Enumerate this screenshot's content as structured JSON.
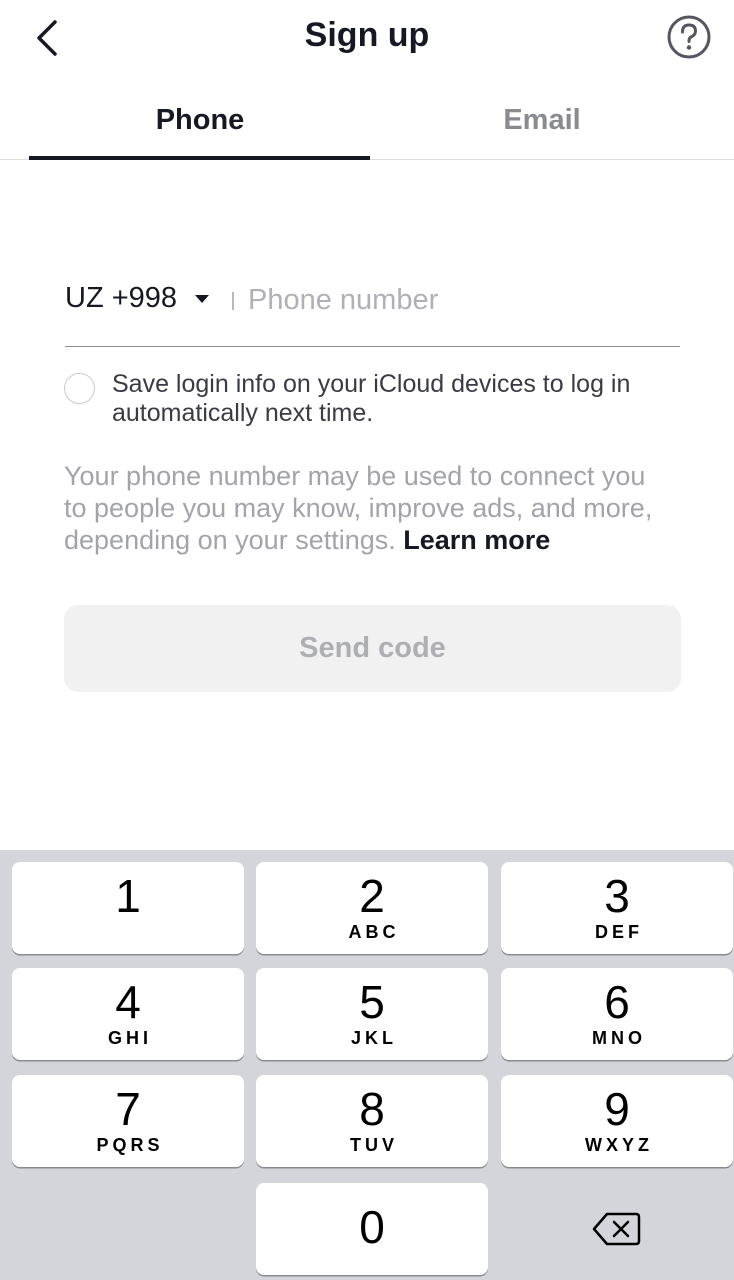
{
  "header": {
    "title": "Sign up",
    "back_icon": "chevron-left-icon",
    "help_icon": "question-circle-icon"
  },
  "tabs": [
    {
      "label": "Phone",
      "active": true
    },
    {
      "label": "Email",
      "active": false
    }
  ],
  "phone_form": {
    "country_code": "UZ +998",
    "phone_placeholder": "Phone number",
    "phone_value": ""
  },
  "save_login": {
    "checked": false,
    "label": "Save login info on your iCloud devices to log in automatically next time."
  },
  "info": {
    "text": "Your phone number may be used to connect you to people you may know, improve ads, and more, depending on your settings. ",
    "link_label": "Learn more"
  },
  "send_button": {
    "label": "Send code",
    "enabled": false
  },
  "keypad": {
    "keys": [
      {
        "number": "1",
        "letters": ""
      },
      {
        "number": "2",
        "letters": "ABC"
      },
      {
        "number": "3",
        "letters": "DEF"
      },
      {
        "number": "4",
        "letters": "GHI"
      },
      {
        "number": "5",
        "letters": "JKL"
      },
      {
        "number": "6",
        "letters": "MNO"
      },
      {
        "number": "7",
        "letters": "PQRS"
      },
      {
        "number": "8",
        "letters": "TUV"
      },
      {
        "number": "9",
        "letters": "WXYZ"
      },
      {
        "number": "0",
        "letters": ""
      }
    ],
    "delete_icon": "backspace-icon"
  },
  "colors": {
    "primary_text": "#161823",
    "muted_text": "#8a8b91",
    "disabled_button_bg": "#f1f1f2",
    "keypad_bg": "#d3d5db"
  }
}
